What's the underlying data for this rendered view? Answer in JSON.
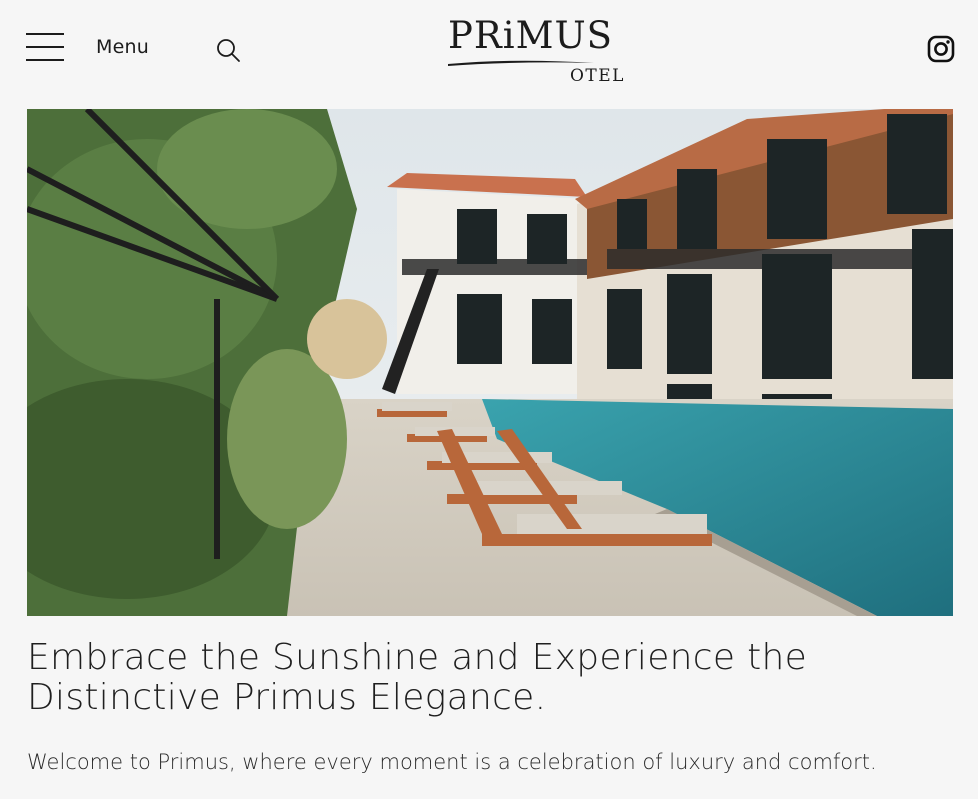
{
  "header": {
    "menu_label": "Menu",
    "logo_main": "PRiMUS",
    "logo_sub": "OTEL",
    "icons": [
      "hamburger-icon",
      "search-icon",
      "instagram-icon"
    ]
  },
  "hero": {
    "image": "hotel-pool-photo"
  },
  "content": {
    "headline_line1": "Embrace the Sunshine and Experience the",
    "headline_line2": "Distinctive Primus Elegance.",
    "lead": "Welcome to Primus, where every moment is a celebration of luxury and comfort."
  },
  "colors": {
    "background": "#f6f6f6",
    "text": "#1c1c1c",
    "pool": "#2f8f9d",
    "wood": "#b8673a"
  }
}
